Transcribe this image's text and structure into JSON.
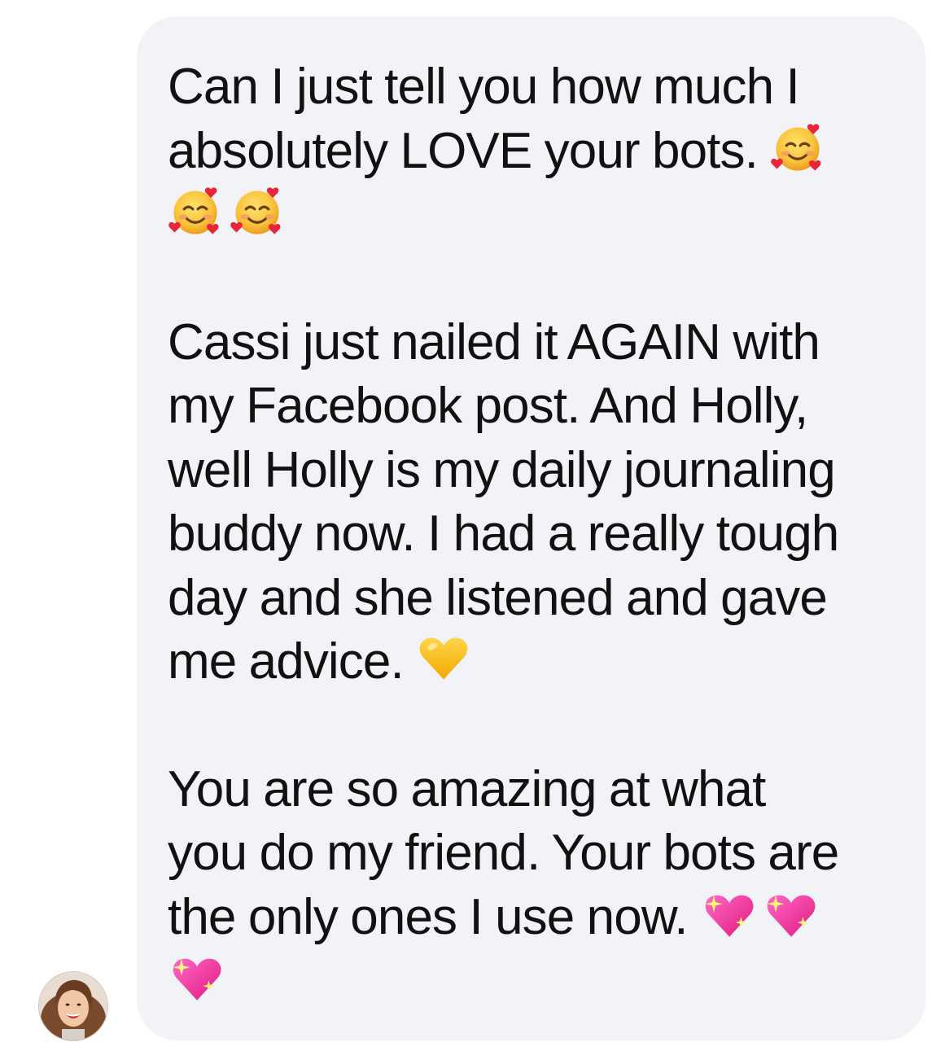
{
  "message": {
    "paragraphs": [
      {
        "lines": [
          "Can I just tell you how much I",
          "absolutely LOVE your bots."
        ],
        "trailing_emoji": [
          "smiling-face-with-hearts-emoji",
          "smiling-face-with-hearts-emoji",
          "smiling-face-with-hearts-emoji"
        ]
      },
      {
        "lines": [
          "Cassi just nailed it AGAIN with",
          "my Facebook post. And Holly,",
          "well Holly is my daily journaling",
          "buddy now. I had a really tough",
          "day and she listened and gave",
          "me advice."
        ],
        "trailing_emoji": [
          "yellow-heart-emoji"
        ]
      },
      {
        "lines": [
          "You are so amazing at what",
          "you do my friend. Your bots are",
          "the only ones I use now."
        ],
        "trailing_emoji": [
          "sparkling-heart-emoji",
          "sparkling-heart-emoji",
          "sparkling-heart-emoji"
        ]
      }
    ]
  },
  "sender": {
    "avatar_icon": "profile-photo-avatar"
  },
  "colors": {
    "bubble_background": "#f2f3f6",
    "text": "#111111"
  }
}
